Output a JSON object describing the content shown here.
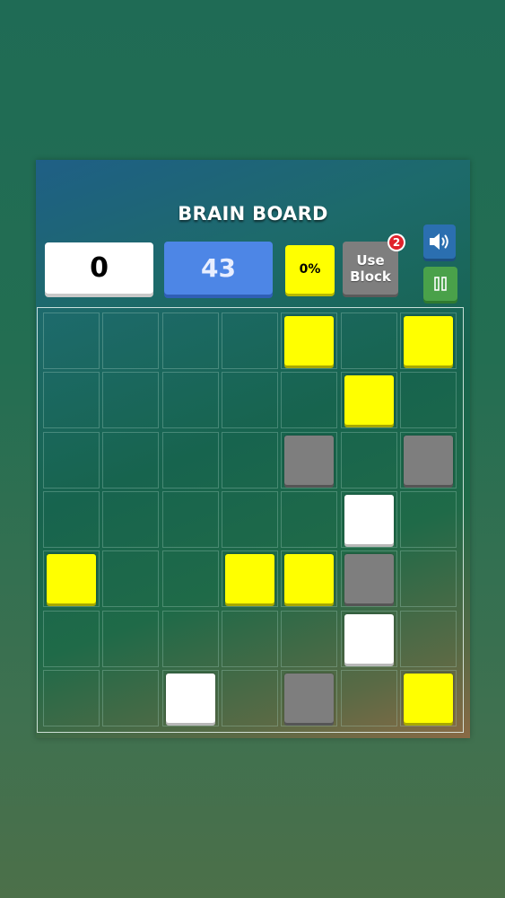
{
  "game": {
    "title": "BRAIN BOARD",
    "score": "0",
    "moves": "43",
    "progress_label": "0%",
    "use_block_line1": "Use",
    "use_block_line2": "Block",
    "use_block_count": "2",
    "sound_icon": "speaker-icon",
    "pause_icon": "pause-icon"
  },
  "colors": {
    "yellow": "#ffff00",
    "white": "#ffffff",
    "gray": "#7e7e7e",
    "moves_blue": "#4d86e6",
    "sound_blue": "#2b6fb0",
    "pause_green": "#4aa14a",
    "badge_red": "#e0212b"
  },
  "board": {
    "rows": 7,
    "cols": 7,
    "tiles": [
      {
        "row": 0,
        "col": 4,
        "color": "yellow"
      },
      {
        "row": 0,
        "col": 6,
        "color": "yellow"
      },
      {
        "row": 1,
        "col": 5,
        "color": "yellow"
      },
      {
        "row": 2,
        "col": 4,
        "color": "gray"
      },
      {
        "row": 2,
        "col": 6,
        "color": "gray"
      },
      {
        "row": 3,
        "col": 5,
        "color": "white"
      },
      {
        "row": 4,
        "col": 0,
        "color": "yellow"
      },
      {
        "row": 4,
        "col": 3,
        "color": "yellow"
      },
      {
        "row": 4,
        "col": 4,
        "color": "yellow"
      },
      {
        "row": 4,
        "col": 5,
        "color": "gray"
      },
      {
        "row": 5,
        "col": 5,
        "color": "white"
      },
      {
        "row": 6,
        "col": 2,
        "color": "white"
      },
      {
        "row": 6,
        "col": 4,
        "color": "gray"
      },
      {
        "row": 6,
        "col": 6,
        "color": "yellow"
      }
    ]
  }
}
